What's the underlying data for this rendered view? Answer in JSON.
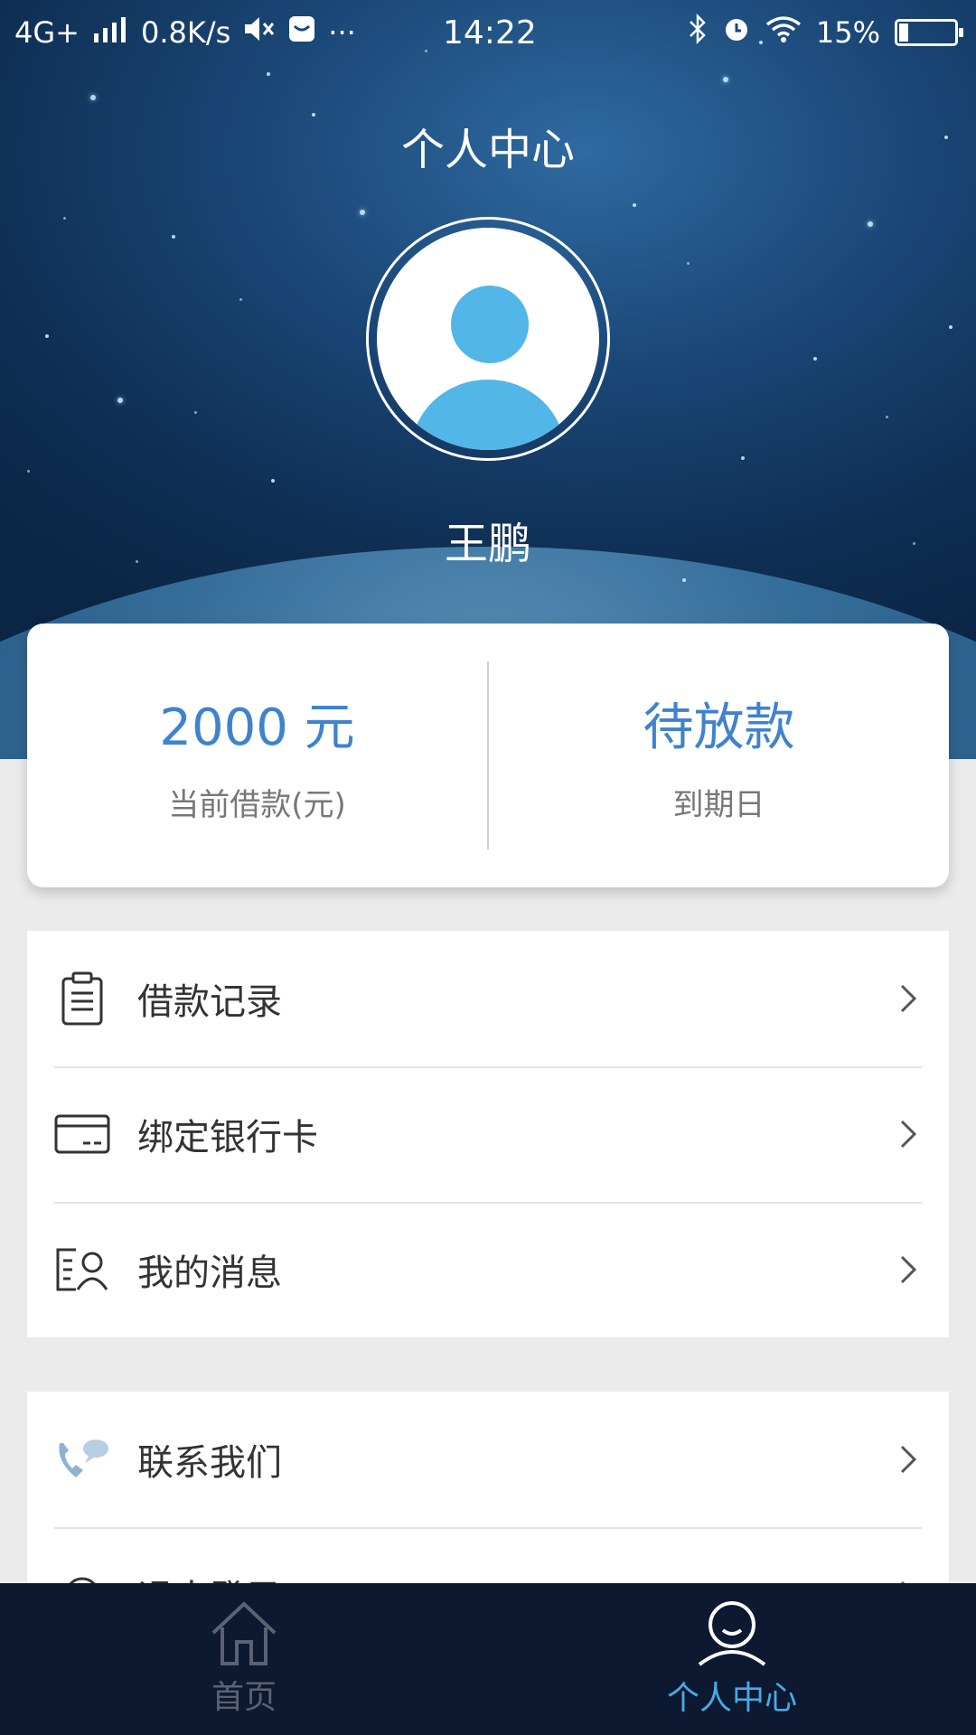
{
  "status_bar": {
    "network": "4G+",
    "speed": "0.8K/s",
    "time": "14:22",
    "battery": "15%"
  },
  "header": {
    "title": "个人中心"
  },
  "profile": {
    "name": "王鹏"
  },
  "summary": {
    "loan_value": "2000 元",
    "loan_label": "当前借款(元)",
    "due_value": "待放款",
    "due_label": "到期日"
  },
  "menu_group_1": [
    {
      "label": "借款记录",
      "icon": "clipboard-icon"
    },
    {
      "label": "绑定银行卡",
      "icon": "bank-card-icon"
    },
    {
      "label": "我的消息",
      "icon": "message-user-icon"
    }
  ],
  "menu_group_2": [
    {
      "label": "联系我们",
      "icon": "phone-chat-icon"
    },
    {
      "label": "退出登录",
      "icon": "gear-icon"
    }
  ],
  "tabbar": {
    "home_label": "首页",
    "profile_label": "个人中心"
  },
  "colors": {
    "accent": "#3f82cf",
    "tab_active": "#49a9e6",
    "avatar": "#53b6e8",
    "tabbar_bg": "#0d1930"
  }
}
